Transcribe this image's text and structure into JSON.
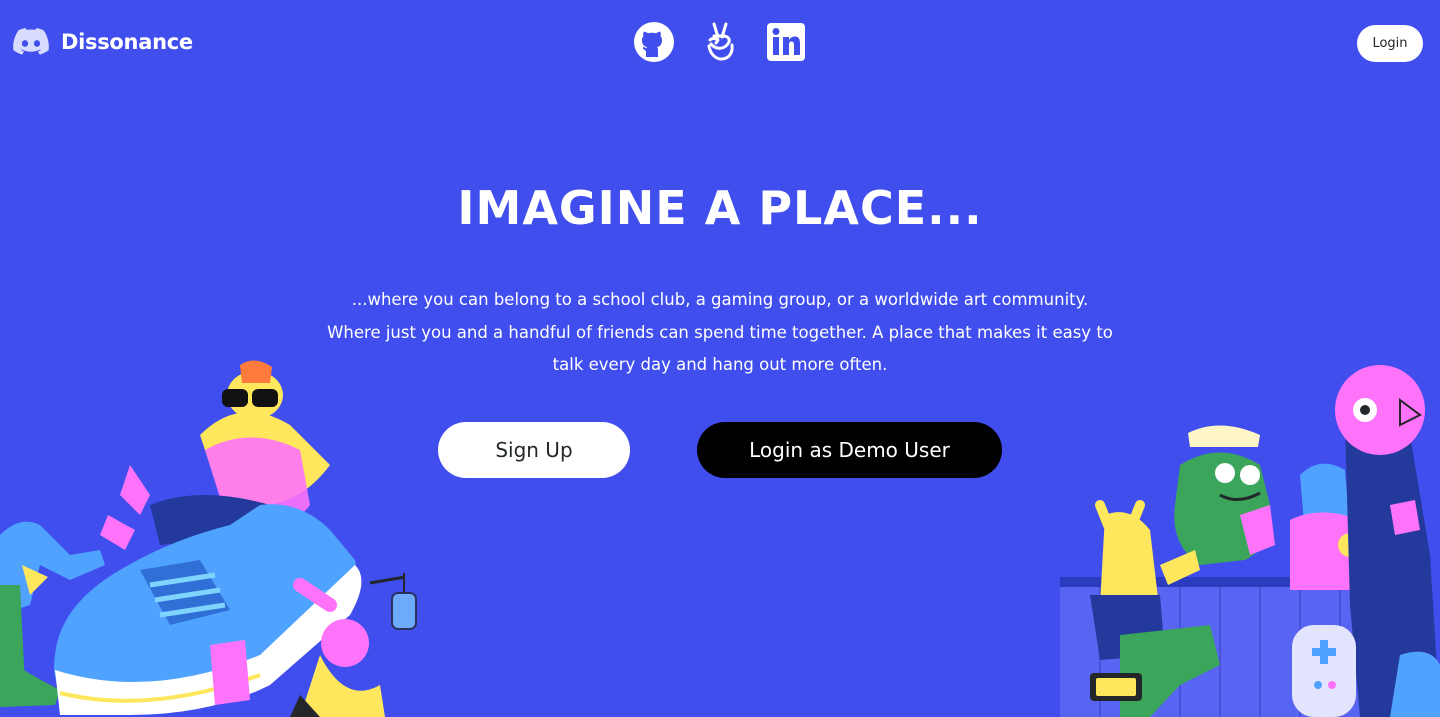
{
  "brand": {
    "name": "Dissonance",
    "logo_icon": "discord-logo-icon"
  },
  "social": [
    {
      "name": "github-icon"
    },
    {
      "name": "angellist-icon"
    },
    {
      "name": "linkedin-icon"
    }
  ],
  "nav": {
    "login_label": "Login"
  },
  "hero": {
    "title": "IMAGINE A PLACE...",
    "text": "...where you can belong to a school club, a gaming group, or a worldwide art community. Where just you and a handful of friends can spend time together. A place that makes it easy to talk every day and hang out more often.",
    "signup_label": "Sign Up",
    "demo_label": "Login as Demo User"
  },
  "colors": {
    "background": "#404eed",
    "button_light": "#ffffff",
    "button_dark": "#000000",
    "text_dark": "#23272a"
  }
}
